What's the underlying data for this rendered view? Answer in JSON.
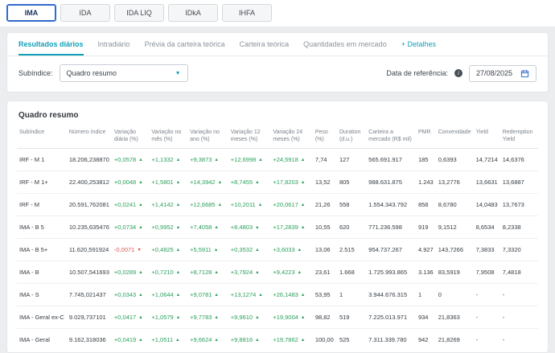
{
  "top_tabs": {
    "items": [
      {
        "label": "IMA",
        "active": true
      },
      {
        "label": "IDA",
        "active": false
      },
      {
        "label": "IDA LIQ",
        "active": false
      },
      {
        "label": "IDkA",
        "active": false
      },
      {
        "label": "IHFA",
        "active": false
      }
    ]
  },
  "sub_tabs": {
    "items": [
      {
        "label": "Resultados diários",
        "active": true
      },
      {
        "label": "Intradiário",
        "active": false
      },
      {
        "label": "Prévia da carteira teórica",
        "active": false
      },
      {
        "label": "Carteira teórica",
        "active": false
      },
      {
        "label": "Quantidades em mercado",
        "active": false
      },
      {
        "label": "+ Detalhes",
        "active": false
      }
    ]
  },
  "filters": {
    "subindex_label": "Subíndice:",
    "subindex_value": "Quadro resumo",
    "date_label": "Data de referência:",
    "date_value": "27/08/2025"
  },
  "colors": {
    "accent_teal": "#119fb8",
    "active_tab_blue": "#2f6bce",
    "positive_green": "#2ba05c",
    "negative_red": "#e05252"
  },
  "table": {
    "title": "Quadro resumo",
    "headers": [
      "Subíndice",
      "Número índice",
      "Variação diária (%)",
      "Variação no mês (%)",
      "Variação no ano (%)",
      "Variação 12 meses (%)",
      "Variação 24 meses (%)",
      "Peso (%)",
      "Duration (d.u.)",
      "Carteira a mercado (R$ mil)",
      "PMR",
      "Convexidade",
      "Yield",
      "Redemption Yield"
    ],
    "rows": [
      [
        "IRF - M 1",
        "18.206,238870",
        {
          "v": "+0,0578",
          "d": "up"
        },
        {
          "v": "+1,1332",
          "d": "up"
        },
        {
          "v": "+9,3873",
          "d": "up"
        },
        {
          "v": "+12,6998",
          "d": "up"
        },
        {
          "v": "+24,5918",
          "d": "up"
        },
        "7,74",
        "127",
        "565.691.917",
        "185",
        "0,6393",
        "14,7214",
        "14,6376"
      ],
      [
        "IRF - M 1+",
        "22.400,253812",
        {
          "v": "+0,0048",
          "d": "up"
        },
        {
          "v": "+1,5801",
          "d": "up"
        },
        {
          "v": "+14,3942",
          "d": "up"
        },
        {
          "v": "+8,7455",
          "d": "up"
        },
        {
          "v": "+17,8203",
          "d": "up"
        },
        "13,52",
        "805",
        "988.631.875",
        "1.243",
        "13,2776",
        "13,6631",
        "13,6887"
      ],
      [
        "IRF - M",
        "20.591,762081",
        {
          "v": "+0,0241",
          "d": "up"
        },
        {
          "v": "+1,4142",
          "d": "up"
        },
        {
          "v": "+12,6685",
          "d": "up"
        },
        {
          "v": "+10,2011",
          "d": "up"
        },
        {
          "v": "+20,0617",
          "d": "up"
        },
        "21,26",
        "558",
        "1.554.343.792",
        "858",
        "8,6780",
        "14,0483",
        "13,7673"
      ],
      [
        "IMA - B 5",
        "10.235,635476",
        {
          "v": "+0,0734",
          "d": "up"
        },
        {
          "v": "+0,9952",
          "d": "up"
        },
        {
          "v": "+7,4058",
          "d": "up"
        },
        {
          "v": "+8,4803",
          "d": "up"
        },
        {
          "v": "+17,2839",
          "d": "up"
        },
        "10,55",
        "620",
        "771.236.598",
        "919",
        "9,1512",
        "8,6534",
        "8,2338"
      ],
      [
        "IMA - B 5+",
        "11.620,591924",
        {
          "v": "-0,0071",
          "d": "down"
        },
        {
          "v": "+0,4825",
          "d": "up"
        },
        {
          "v": "+5,5911",
          "d": "up"
        },
        {
          "v": "+0,3532",
          "d": "up"
        },
        {
          "v": "+3,6033",
          "d": "up"
        },
        "13,06",
        "2.515",
        "954.737.267",
        "4.927",
        "143,7266",
        "7,3833",
        "7,3320"
      ],
      [
        "IMA - B",
        "10.507,541693",
        {
          "v": "+0,0289",
          "d": "up"
        },
        {
          "v": "+0,7210",
          "d": "up"
        },
        {
          "v": "+8,7128",
          "d": "up"
        },
        {
          "v": "+3,7924",
          "d": "up"
        },
        {
          "v": "+9,4223",
          "d": "up"
        },
        "23,61",
        "1.668",
        "1.725.993.865",
        "3.136",
        "83,5919",
        "7,9508",
        "7,4818"
      ],
      [
        "IMA - S",
        "7.745,021437",
        {
          "v": "+0,0343",
          "d": "up"
        },
        {
          "v": "+1,0644",
          "d": "up"
        },
        {
          "v": "+9,0781",
          "d": "up"
        },
        {
          "v": "+13,1274",
          "d": "up"
        },
        {
          "v": "+26,1483",
          "d": "up"
        },
        "53,95",
        "1",
        "3.944.676.315",
        "1",
        "0",
        "-",
        "-"
      ],
      [
        "IMA - Geral ex-C",
        "9.029,737101",
        {
          "v": "+0,0417",
          "d": "up"
        },
        {
          "v": "+1,0579",
          "d": "up"
        },
        {
          "v": "+9,7783",
          "d": "up"
        },
        {
          "v": "+9,9610",
          "d": "up"
        },
        {
          "v": "+19,9004",
          "d": "up"
        },
        "98,82",
        "519",
        "7.225.013.971",
        "934",
        "21,8363",
        "-",
        "-"
      ],
      [
        "IMA - Geral",
        "9.162,318036",
        {
          "v": "+0,0419",
          "d": "up"
        },
        {
          "v": "+1,0511",
          "d": "up"
        },
        {
          "v": "+9,6624",
          "d": "up"
        },
        {
          "v": "+9,8816",
          "d": "up"
        },
        {
          "v": "+19,7862",
          "d": "up"
        },
        "100,00",
        "525",
        "7.311.339.780",
        "942",
        "21,8269",
        "-",
        "-"
      ]
    ]
  }
}
